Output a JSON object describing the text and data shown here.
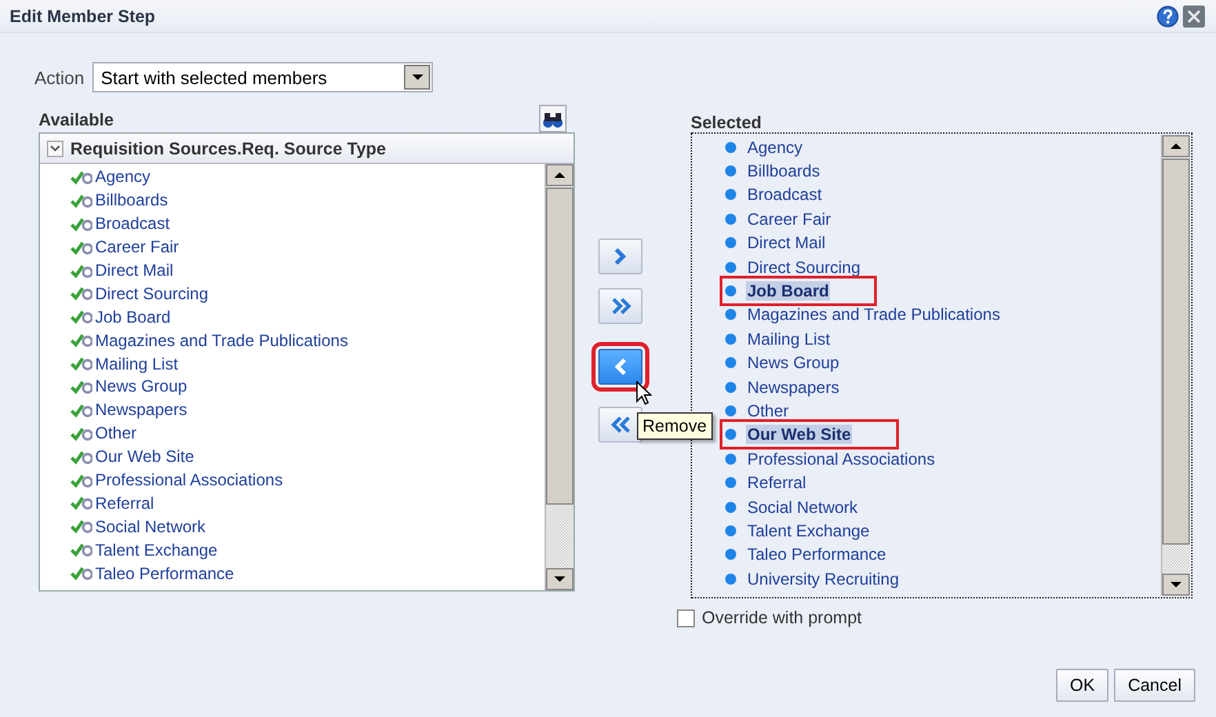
{
  "window": {
    "title": "Edit Member Step"
  },
  "action": {
    "label": "Action",
    "value": "Start with selected members"
  },
  "available": {
    "label": "Available",
    "group": "Requisition Sources.Req. Source Type",
    "expanded": true,
    "items": [
      {
        "label": "Agency"
      },
      {
        "label": "Billboards"
      },
      {
        "label": "Broadcast"
      },
      {
        "label": "Career Fair"
      },
      {
        "label": "Direct Mail"
      },
      {
        "label": "Direct Sourcing"
      },
      {
        "label": "Job Board"
      },
      {
        "label": "Magazines and Trade Publications"
      },
      {
        "label": "Mailing List"
      },
      {
        "label": "News Group"
      },
      {
        "label": "Newspapers"
      },
      {
        "label": "Other"
      },
      {
        "label": "Our Web Site"
      },
      {
        "label": "Professional Associations"
      },
      {
        "label": "Referral"
      },
      {
        "label": "Social Network"
      },
      {
        "label": "Talent Exchange"
      },
      {
        "label": "Taleo Performance"
      }
    ]
  },
  "move_buttons": [
    {
      "kind": "add",
      "hovered": false
    },
    {
      "kind": "add_all",
      "hovered": false
    },
    {
      "kind": "remove",
      "hovered": true
    },
    {
      "kind": "remove_all",
      "hovered": false
    }
  ],
  "tooltip": "Remove",
  "selected": {
    "label": "Selected",
    "items": [
      {
        "label": "Agency",
        "selected": false
      },
      {
        "label": "Billboards",
        "selected": false
      },
      {
        "label": "Broadcast",
        "selected": false
      },
      {
        "label": "Career Fair",
        "selected": false
      },
      {
        "label": "Direct Mail",
        "selected": false
      },
      {
        "label": "Direct Sourcing",
        "selected": false
      },
      {
        "label": "Job Board",
        "selected": true
      },
      {
        "label": "Magazines and Trade Publications",
        "selected": false
      },
      {
        "label": "Mailing List",
        "selected": false
      },
      {
        "label": "News Group",
        "selected": false
      },
      {
        "label": "Newspapers",
        "selected": false
      },
      {
        "label": "Other",
        "selected": false
      },
      {
        "label": "Our Web Site",
        "selected": true
      },
      {
        "label": "Professional Associations",
        "selected": false
      },
      {
        "label": "Referral",
        "selected": false
      },
      {
        "label": "Social Network",
        "selected": false
      },
      {
        "label": "Talent Exchange",
        "selected": false
      },
      {
        "label": "Taleo Performance",
        "selected": false
      },
      {
        "label": "University Recruiting",
        "selected": false
      }
    ]
  },
  "override": {
    "label": "Override with prompt",
    "checked": false
  },
  "buttons": [
    "OK",
    "Cancel"
  ]
}
